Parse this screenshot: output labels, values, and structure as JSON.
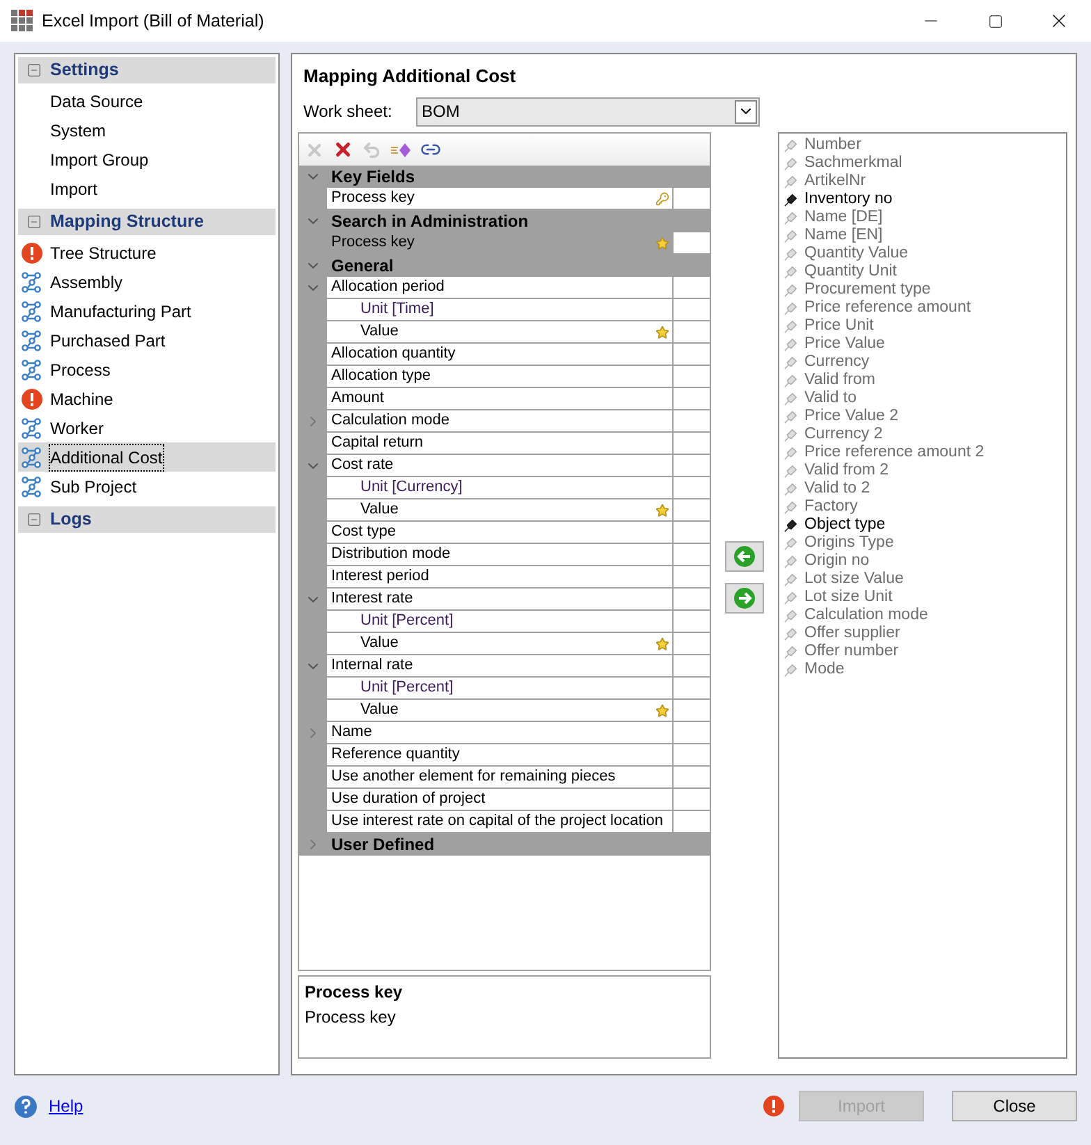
{
  "window": {
    "title": "Excel Import (Bill of Material)"
  },
  "sidebar": {
    "sections": [
      {
        "title": "Settings",
        "expanded": true,
        "items": [
          {
            "label": "Data Source",
            "kind": "plain",
            "selected": false
          },
          {
            "label": "System",
            "kind": "plain",
            "selected": false
          },
          {
            "label": "Import Group",
            "kind": "plain",
            "selected": false
          },
          {
            "label": "Import",
            "kind": "plain",
            "selected": false
          }
        ]
      },
      {
        "title": "Mapping Structure",
        "expanded": true,
        "items": [
          {
            "label": "Tree Structure",
            "kind": "error",
            "selected": false
          },
          {
            "label": "Assembly",
            "kind": "structure",
            "selected": false
          },
          {
            "label": "Manufacturing Part",
            "kind": "structure",
            "selected": false
          },
          {
            "label": "Purchased Part",
            "kind": "structure",
            "selected": false
          },
          {
            "label": "Process",
            "kind": "structure",
            "selected": false
          },
          {
            "label": "Machine",
            "kind": "error",
            "selected": false
          },
          {
            "label": "Worker",
            "kind": "structure",
            "selected": false
          },
          {
            "label": "Additional Cost",
            "kind": "structure",
            "selected": true
          },
          {
            "label": "Sub Project",
            "kind": "structure",
            "selected": false
          }
        ]
      },
      {
        "title": "Logs",
        "expanded": true
      }
    ]
  },
  "main": {
    "title": "Mapping Additional Cost",
    "worksheet": {
      "label": "Work sheet:",
      "value": "BOM"
    },
    "grid": {
      "sections": [
        {
          "title": "Key Fields",
          "expanded": true,
          "rows": [
            {
              "label": "Process key",
              "kind": "key",
              "selected": false
            }
          ]
        },
        {
          "title": "Search in Administration",
          "expanded": true,
          "rows": [
            {
              "label": "Process key",
              "kind": "starred",
              "selected": true
            }
          ]
        },
        {
          "title": "General",
          "expanded": true,
          "rows": [
            {
              "label": "Allocation period",
              "selected": false,
              "expanded": true,
              "children": [
                {
                  "label": "Unit  [Time]",
                  "kind": "unit",
                  "selected": false
                },
                {
                  "label": "Value",
                  "kind": "starred",
                  "selected": false
                }
              ]
            },
            {
              "label": "Allocation quantity",
              "selected": false
            },
            {
              "label": "Allocation type",
              "selected": false
            },
            {
              "label": "Amount",
              "selected": false
            },
            {
              "label": "Calculation mode",
              "selected": false,
              "expanded": false
            },
            {
              "label": "Capital return",
              "selected": false
            },
            {
              "label": "Cost rate",
              "selected": false,
              "expanded": true,
              "children": [
                {
                  "label": "Unit  [Currency]",
                  "kind": "unit",
                  "selected": false
                },
                {
                  "label": "Value",
                  "kind": "starred",
                  "selected": false
                }
              ]
            },
            {
              "label": "Cost type",
              "selected": false
            },
            {
              "label": "Distribution mode",
              "selected": false
            },
            {
              "label": "Interest period",
              "selected": false
            },
            {
              "label": "Interest rate",
              "selected": false,
              "expanded": true,
              "children": [
                {
                  "label": "Unit  [Percent]",
                  "kind": "unit",
                  "selected": false
                },
                {
                  "label": "Value",
                  "kind": "starred",
                  "selected": false
                }
              ]
            },
            {
              "label": "Internal rate",
              "selected": false,
              "expanded": true,
              "children": [
                {
                  "label": "Unit  [Percent]",
                  "kind": "unit",
                  "selected": false
                },
                {
                  "label": "Value",
                  "kind": "starred",
                  "selected": false
                }
              ]
            },
            {
              "label": "Name",
              "selected": false,
              "expanded": false
            },
            {
              "label": "Reference quantity",
              "selected": false
            },
            {
              "label": "Use another element for remaining pieces",
              "selected": false
            },
            {
              "label": "Use duration of project",
              "selected": false
            },
            {
              "label": "Use interest rate on capital of the project location",
              "selected": false
            }
          ]
        },
        {
          "title": "User Defined",
          "expanded": false
        }
      ]
    },
    "description": {
      "title": "Process key",
      "text": "Process key"
    },
    "columns": [
      {
        "label": "Number",
        "mapped": false
      },
      {
        "label": "Sachmerkmal",
        "mapped": false
      },
      {
        "label": "ArtikelNr",
        "mapped": false
      },
      {
        "label": "Inventory no",
        "mapped": true
      },
      {
        "label": "Name [DE]",
        "mapped": false
      },
      {
        "label": "Name [EN]",
        "mapped": false
      },
      {
        "label": "Quantity Value",
        "mapped": false
      },
      {
        "label": "Quantity Unit",
        "mapped": false
      },
      {
        "label": "Procurement type",
        "mapped": false
      },
      {
        "label": "Price reference amount",
        "mapped": false
      },
      {
        "label": "Price Unit",
        "mapped": false
      },
      {
        "label": "Price Value",
        "mapped": false
      },
      {
        "label": "Currency",
        "mapped": false
      },
      {
        "label": "Valid from",
        "mapped": false
      },
      {
        "label": "Valid to",
        "mapped": false
      },
      {
        "label": "Price Value 2",
        "mapped": false
      },
      {
        "label": "Currency 2",
        "mapped": false
      },
      {
        "label": "Price reference amount 2",
        "mapped": false
      },
      {
        "label": "Valid from 2",
        "mapped": false
      },
      {
        "label": "Valid to 2",
        "mapped": false
      },
      {
        "label": "Factory",
        "mapped": false
      },
      {
        "label": "Object type",
        "mapped": true
      },
      {
        "label": "Origins Type",
        "mapped": false
      },
      {
        "label": "Origin no",
        "mapped": false
      },
      {
        "label": "Lot size Value",
        "mapped": false
      },
      {
        "label": "Lot size Unit",
        "mapped": false
      },
      {
        "label": "Calculation mode",
        "mapped": false
      },
      {
        "label": "Offer supplier",
        "mapped": false
      },
      {
        "label": "Offer number",
        "mapped": false
      },
      {
        "label": "Mode",
        "mapped": false
      }
    ]
  },
  "footer": {
    "help": "Help",
    "import": {
      "label": "Import",
      "disabled": true
    },
    "close": {
      "label": "Close",
      "disabled": false
    }
  }
}
